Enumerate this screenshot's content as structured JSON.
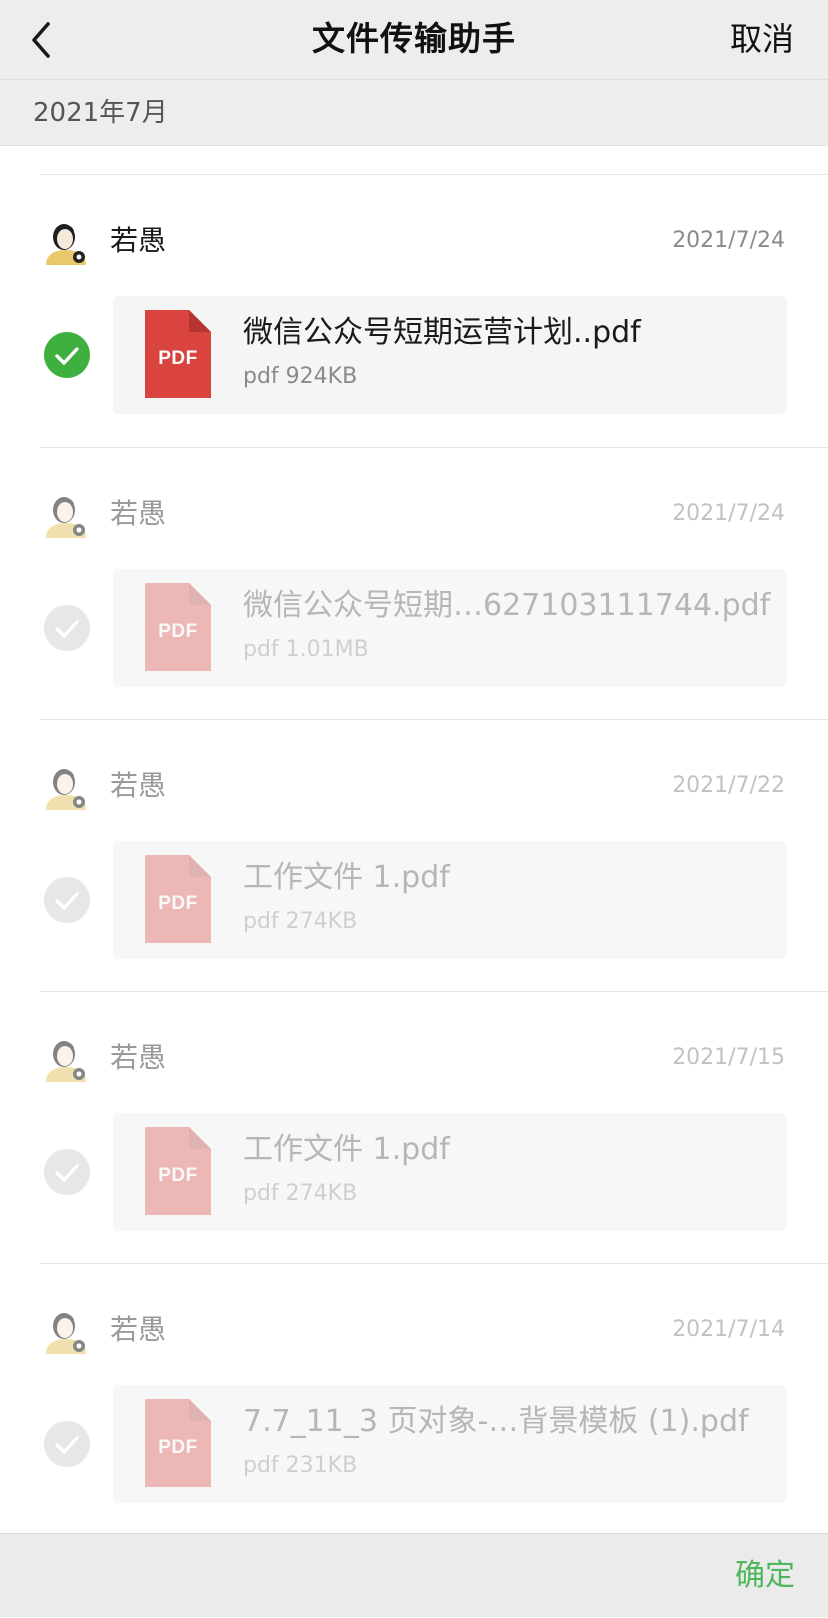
{
  "navbar": {
    "title": "文件传输助手",
    "cancel_label": "取消",
    "back_icon": "chevron-left-icon"
  },
  "month_header": "2021年7月",
  "messages": [
    {
      "sender": "若愚",
      "date": "2021/7/24",
      "selected": true,
      "file": {
        "icon": "pdf-icon",
        "icon_label": "PDF",
        "name": "微信公众号短期运营计划..pdf",
        "meta": "pdf 924KB"
      }
    },
    {
      "sender": "若愚",
      "date": "2021/7/24",
      "selected": false,
      "file": {
        "icon": "pdf-icon",
        "icon_label": "PDF",
        "name": "微信公众号短期…627103111744.pdf",
        "meta": "pdf 1.01MB"
      }
    },
    {
      "sender": "若愚",
      "date": "2021/7/22",
      "selected": false,
      "file": {
        "icon": "pdf-icon",
        "icon_label": "PDF",
        "name": "工作文件 1.pdf",
        "meta": "pdf 274KB"
      }
    },
    {
      "sender": "若愚",
      "date": "2021/7/15",
      "selected": false,
      "file": {
        "icon": "pdf-icon",
        "icon_label": "PDF",
        "name": "工作文件 1.pdf",
        "meta": "pdf 274KB"
      }
    },
    {
      "sender": "若愚",
      "date": "2021/7/14",
      "selected": false,
      "file": {
        "icon": "pdf-icon",
        "icon_label": "PDF",
        "name": "7.7_11_3 页对象-…背景模板 (1).pdf",
        "meta": "pdf 231KB"
      }
    }
  ],
  "bottom_bar": {
    "confirm_label": "确定"
  },
  "colors": {
    "accent_green": "#3eb03f",
    "confirm_text": "#4fb65a",
    "pdf_red": "#d9443f",
    "nav_background": "#ededed"
  }
}
